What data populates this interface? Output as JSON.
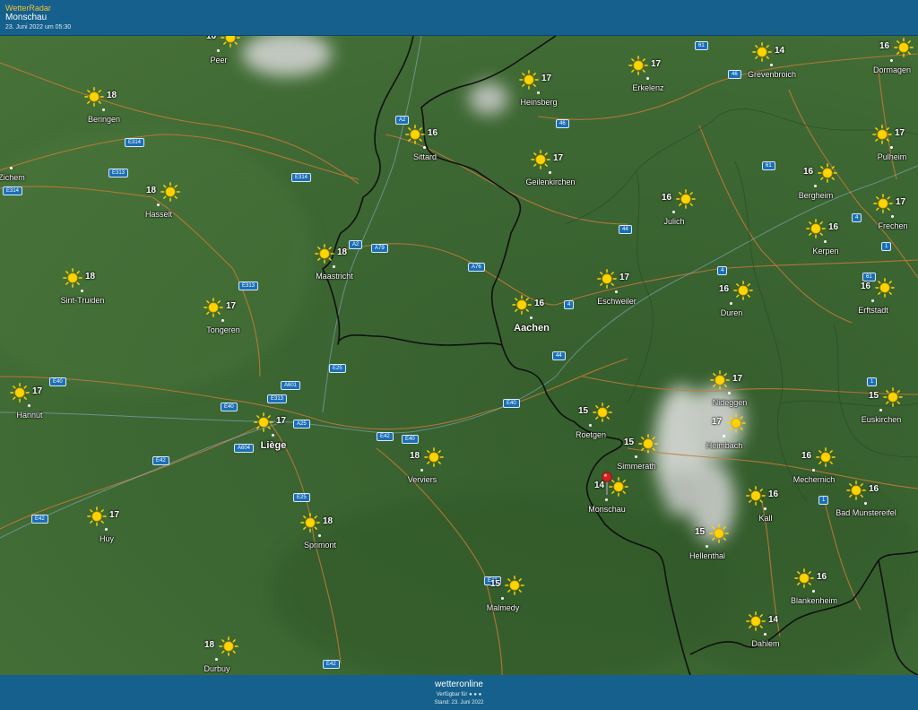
{
  "header": {
    "app_name": "WetterRadar",
    "location": "Monschau",
    "timestamp": "23. Juni 2022 um 05:30"
  },
  "colors": {
    "header_bg": "#15608c",
    "app_name": "#f2c23a",
    "map_green": "#3f6a35",
    "sun": "#ffd400",
    "pin": "#d6201f",
    "road_badge": "#1b6fb6"
  },
  "cities": [
    {
      "name": "Peer",
      "temp": "16",
      "icon": "sun-icon"
    },
    {
      "name": "Beringen",
      "temp": "18",
      "icon": "sun-icon"
    },
    {
      "name": "Zichem",
      "temp": "",
      "icon": ""
    },
    {
      "name": "Hasselt",
      "temp": "18",
      "icon": "sun-icon"
    },
    {
      "name": "Sint-Truiden",
      "temp": "18",
      "icon": "sun-icon"
    },
    {
      "name": "Tongeren",
      "temp": "17",
      "icon": "sun-icon"
    },
    {
      "name": "Hannut",
      "temp": "17",
      "icon": "sun-icon"
    },
    {
      "name": "Huy",
      "temp": "17",
      "icon": "sun-icon"
    },
    {
      "name": "Liège",
      "temp": "17",
      "icon": "sun-icon"
    },
    {
      "name": "Sprimont",
      "temp": "18",
      "icon": "sun-icon"
    },
    {
      "name": "Durbuy",
      "temp": "18",
      "icon": "sun-icon"
    },
    {
      "name": "Verviers",
      "temp": "18",
      "icon": "sun-icon"
    },
    {
      "name": "Malmedy",
      "temp": "15",
      "icon": "sun-icon"
    },
    {
      "name": "Maastricht",
      "temp": "18",
      "icon": "sun-icon"
    },
    {
      "name": "Sittard",
      "temp": "16",
      "icon": "sun-icon"
    },
    {
      "name": "Heinsberg",
      "temp": "17",
      "icon": "sun-icon"
    },
    {
      "name": "Erkelenz",
      "temp": "17",
      "icon": "sun-icon"
    },
    {
      "name": "Grevenbroich",
      "temp": "14",
      "icon": "sun-icon"
    },
    {
      "name": "Dormagen",
      "temp": "16",
      "icon": "sun-icon"
    },
    {
      "name": "Geilenkirchen",
      "temp": "17",
      "icon": "sun-icon"
    },
    {
      "name": "Pulheim",
      "temp": "17",
      "icon": "sun-icon"
    },
    {
      "name": "Bergheim",
      "temp": "16",
      "icon": "sun-icon"
    },
    {
      "name": "Julich",
      "temp": "16",
      "icon": "sun-icon"
    },
    {
      "name": "Frechen",
      "temp": "17",
      "icon": "sun-icon"
    },
    {
      "name": "Kerpen",
      "temp": "16",
      "icon": "sun-icon"
    },
    {
      "name": "Aachen",
      "temp": "16",
      "icon": "sun-icon"
    },
    {
      "name": "Eschweiler",
      "temp": "17",
      "icon": "sun-icon"
    },
    {
      "name": "Duren",
      "temp": "16",
      "icon": "sun-icon"
    },
    {
      "name": "Erftstadt",
      "temp": "16",
      "icon": "sun-icon"
    },
    {
      "name": "Nideggen",
      "temp": "17",
      "icon": "sun-icon"
    },
    {
      "name": "Euskirchen",
      "temp": "15",
      "icon": "sun-icon"
    },
    {
      "name": "Roetgen",
      "temp": "15",
      "icon": "sun-icon"
    },
    {
      "name": "Heimbach",
      "temp": "17",
      "icon": "sun-icon"
    },
    {
      "name": "Simmerath",
      "temp": "15",
      "icon": "sun-icon"
    },
    {
      "name": "Mechernich",
      "temp": "16",
      "icon": "sun-icon"
    },
    {
      "name": "Monschau",
      "temp": "14",
      "icon": "sun-icon"
    },
    {
      "name": "Kall",
      "temp": "16",
      "icon": "sun-icon"
    },
    {
      "name": "Bad Munstereifel",
      "temp": "16",
      "icon": "sun-icon"
    },
    {
      "name": "Hellenthal",
      "temp": "15",
      "icon": "sun-icon"
    },
    {
      "name": "Blankenheim",
      "temp": "16",
      "icon": "sun-icon"
    },
    {
      "name": "Dahlem",
      "temp": "14",
      "icon": "sun-icon"
    }
  ],
  "roads": [
    "61",
    "46",
    "46",
    "A2",
    "E314",
    "E313",
    "E314",
    "E314",
    "A2",
    "A79",
    "A76",
    "44",
    "61",
    "4",
    "4",
    "1",
    "61",
    "E313",
    "4",
    "44",
    "E25",
    "A601",
    "E313",
    "E40",
    "E40",
    "A25",
    "E40",
    "E42",
    "E40",
    "A604",
    "E42",
    "1",
    "1",
    "E25",
    "E42",
    "E42",
    "E25",
    "E42"
  ],
  "footer": {
    "brand": "wetteronline",
    "available": "Verfügbar für",
    "stand": "Stand: 23. Juni 2022"
  }
}
